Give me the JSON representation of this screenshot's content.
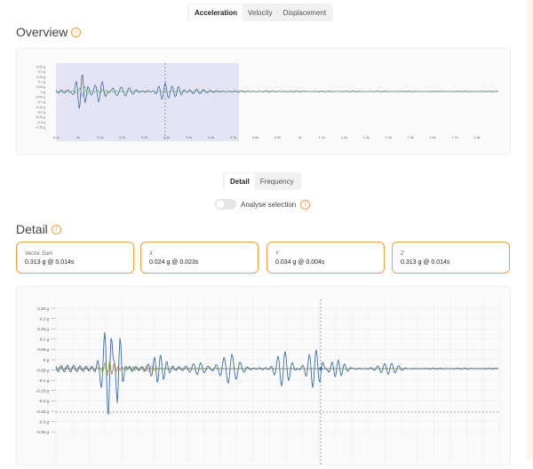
{
  "tabs": [
    {
      "label": "Acceleration",
      "active": true
    },
    {
      "label": "Velocity",
      "active": false
    },
    {
      "label": "Displacement",
      "active": false
    }
  ],
  "overview": {
    "title": "Overview",
    "yticks": [
      "0.25 g",
      "0.2 g",
      "0.15 g",
      "0.1 g",
      "0.05 g",
      "0 g",
      "-0.05 g",
      "-0.1 g",
      "-0.15 g",
      "-0.2 g",
      "-0.25 g",
      "-0.3 g",
      "-0.35 g"
    ],
    "xticks": [
      "-0.1s",
      "0s",
      "0.1s",
      "0.2s",
      "0.3s",
      "0.4s",
      "0.5s",
      "0.6s",
      "0.7s",
      "0.8s",
      "0.9s",
      "1s",
      "1.1s",
      "1.2s",
      "1.3s",
      "1.4s",
      "1.5s",
      "1.6s",
      "1.7s",
      "1.8s"
    ]
  },
  "detail_tabs": [
    {
      "label": "Detail",
      "active": true
    },
    {
      "label": "Frequency",
      "active": false
    }
  ],
  "toggle": {
    "label": "Analyse selection",
    "on": false
  },
  "detail": {
    "title": "Detail",
    "cards": [
      {
        "label": "Vector Sum",
        "value": "0.313 g @ 0.014s"
      },
      {
        "label": "X",
        "value": "0.024 g @ 0.023s"
      },
      {
        "label": "Y",
        "value": "0.034 g @ 0.004s"
      },
      {
        "label": "Z",
        "value": "0.313 g @ 0.014s"
      }
    ],
    "yticks": [
      "0.25 g",
      "0.2 g",
      "0.15 g",
      "0.1 g",
      "0.05 g",
      "0 g",
      "-0.05 g",
      "-0.1 g",
      "-0.15 g",
      "-0.2 g",
      "-0.25 g",
      "-0.3 g",
      "-0.35 g"
    ]
  },
  "colors": {
    "accent": "#f0a040",
    "z_series": "#3a6ea5",
    "x_series": "#e07c4a",
    "y_series": "#6aa84f",
    "selection": "#dcdcf3"
  }
}
